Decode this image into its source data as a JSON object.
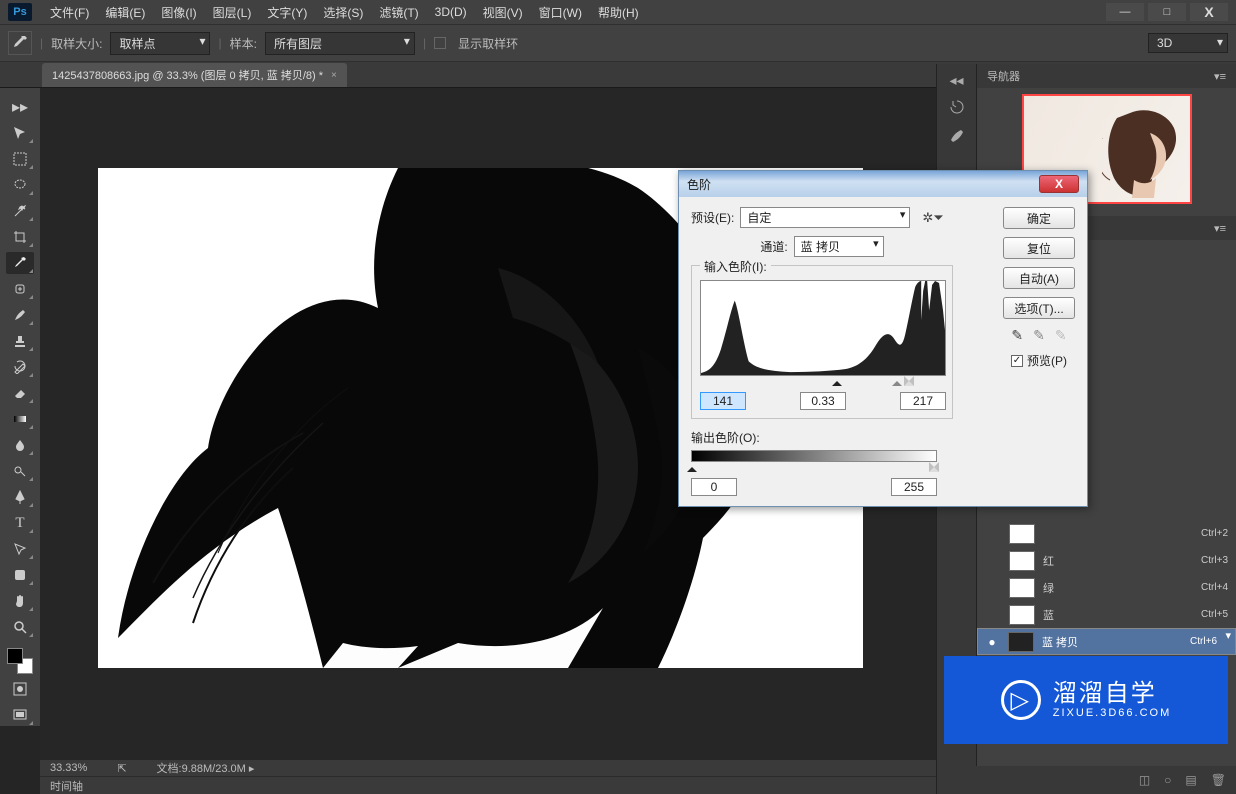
{
  "app": {
    "logo": "Ps"
  },
  "menu": [
    "文件(F)",
    "编辑(E)",
    "图像(I)",
    "图层(L)",
    "文字(Y)",
    "选择(S)",
    "滤镜(T)",
    "3D(D)",
    "视图(V)",
    "窗口(W)",
    "帮助(H)"
  ],
  "win_controls": {
    "min": "—",
    "max": "□",
    "close": "X"
  },
  "options": {
    "sample_size_label": "取样大小:",
    "sample_size_value": "取样点",
    "sample_label": "样本:",
    "sample_value": "所有图层",
    "show_ring": "显示取样环",
    "mode3d": "3D"
  },
  "tab": {
    "title": "1425437808663.jpg @ 33.3% (图层 0 拷贝, 蓝 拷贝/8) *"
  },
  "status": {
    "zoom": "33.33%",
    "doc_label": "文档:",
    "doc_size": "9.88M/23.0M"
  },
  "timeline": {
    "label": "时间轴"
  },
  "navigator": {
    "title": "导航器"
  },
  "channels": [
    {
      "name": "",
      "shortcut": "Ctrl+2",
      "eye": ""
    },
    {
      "name": "红",
      "shortcut": "Ctrl+3",
      "eye": ""
    },
    {
      "name": "绿",
      "shortcut": "Ctrl+4",
      "eye": ""
    },
    {
      "name": "蓝",
      "shortcut": "Ctrl+5",
      "eye": ""
    },
    {
      "name": "蓝 拷贝",
      "shortcut": "Ctrl+6",
      "eye": "●",
      "selected": true,
      "dark": true
    }
  ],
  "dialog": {
    "title": "色阶",
    "preset_label": "预设(E):",
    "preset_value": "自定",
    "channel_label": "通道:",
    "channel_value": "蓝 拷贝",
    "input_label": "输入色阶(I):",
    "output_label": "输出色阶(O):",
    "in_black": "141",
    "in_gamma": "0.33",
    "in_white": "217",
    "out_black": "0",
    "out_white": "255",
    "ok": "确定",
    "reset": "复位",
    "auto": "自动(A)",
    "options": "选项(T)...",
    "preview": "预览(P)"
  },
  "watermark": {
    "main": "溜溜自学",
    "sub": "ZIXUE.3D66.COM",
    "play": "▷"
  },
  "tools": [
    "↔",
    "⬚",
    "◯",
    "✦",
    "✂",
    "✎",
    "✎",
    "✎",
    "⟳",
    "✎",
    "✎",
    "◬",
    "○",
    "✎",
    "T",
    "↖",
    "✋",
    "✥",
    "🔍"
  ]
}
